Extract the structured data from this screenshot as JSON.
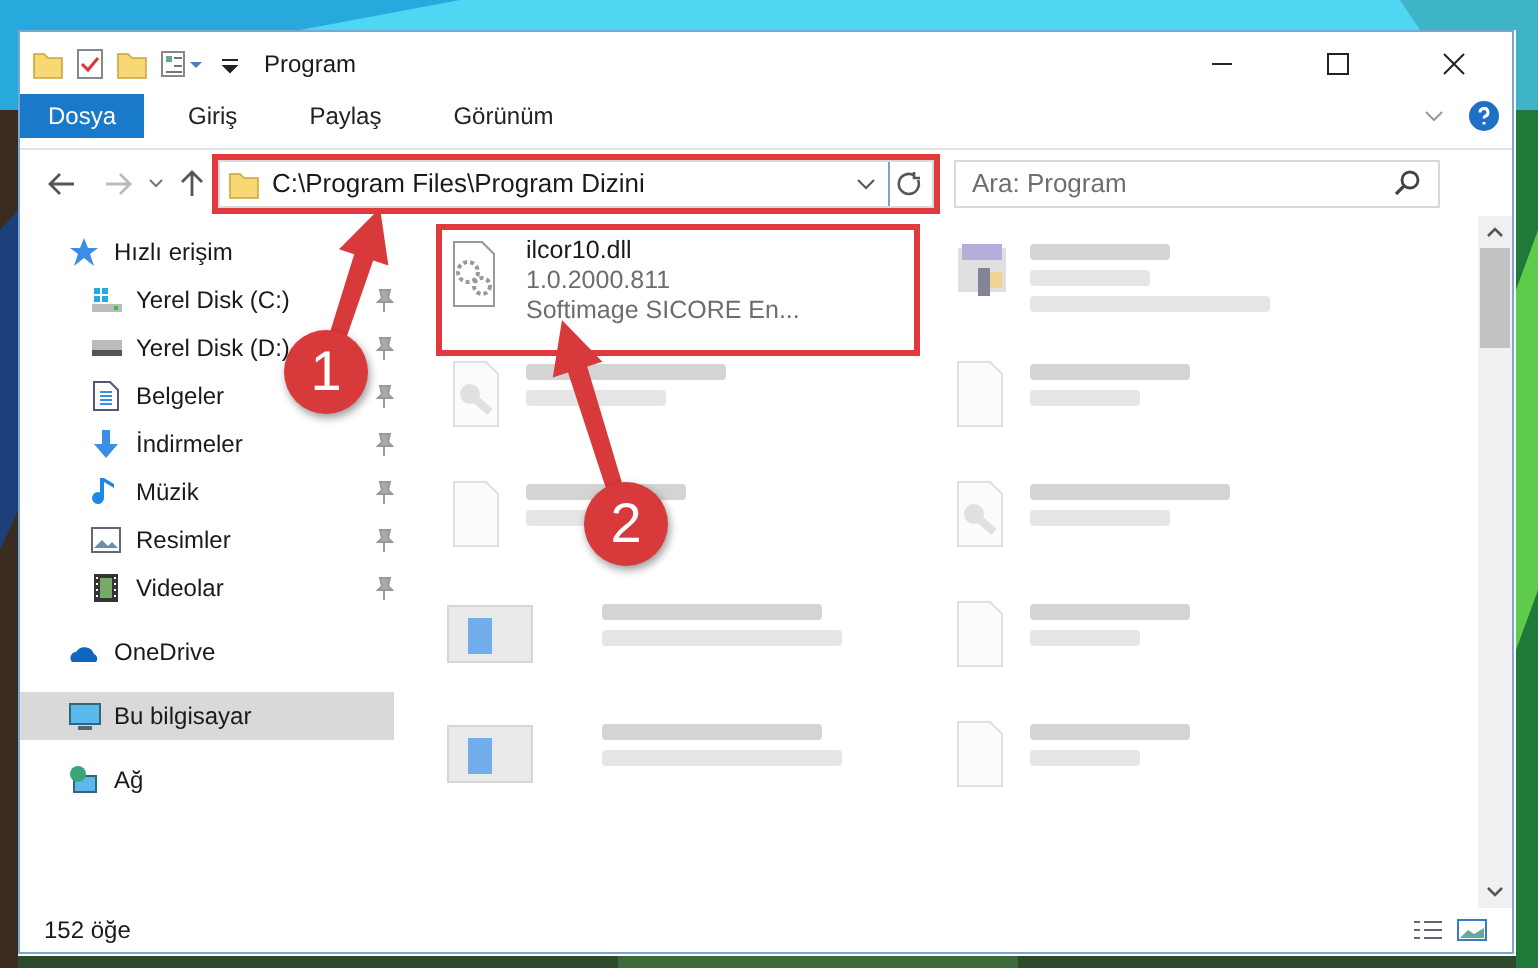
{
  "window": {
    "title": "Program"
  },
  "ribbon_tabs": [
    {
      "label": "Dosya",
      "selected": true
    },
    {
      "label": "Giriş",
      "selected": false
    },
    {
      "label": "Paylaş",
      "selected": false
    },
    {
      "label": "Görünüm",
      "selected": false
    }
  ],
  "address_bar": {
    "path": "C:\\Program Files\\Program Dizini",
    "highlighted": true
  },
  "search": {
    "placeholder": "Ara: Program"
  },
  "nav_pane": [
    {
      "label": "Hızlı erişim",
      "kind": "star",
      "selected": false,
      "children": [
        {
          "label": "Yerel Disk (C:)",
          "kind": "windrive",
          "pinned": true
        },
        {
          "label": "Yerel Disk (D:)",
          "kind": "drive",
          "pinned": true
        },
        {
          "label": "Belgeler",
          "kind": "docs",
          "pinned": true
        },
        {
          "label": "İndirmeler",
          "kind": "download",
          "pinned": true
        },
        {
          "label": "Müzik",
          "kind": "music",
          "pinned": true
        },
        {
          "label": "Resimler",
          "kind": "pictures",
          "pinned": true
        },
        {
          "label": "Videolar",
          "kind": "video",
          "pinned": true
        }
      ]
    },
    {
      "label": "OneDrive",
      "kind": "cloud",
      "selected": false
    },
    {
      "label": "Bu bilgisayar",
      "kind": "pc",
      "selected": true
    },
    {
      "label": "Ağ",
      "kind": "network",
      "selected": false
    }
  ],
  "files": [
    {
      "name": "ilcor10.dll",
      "lines": [
        "1.0.2000.811",
        "Softimage SICORE En..."
      ],
      "kind": "gears",
      "blurred": false,
      "highlighted": true
    },
    {
      "kind": "app",
      "blurred": true,
      "highlighted": false
    },
    {
      "kind": "key",
      "blurred": true,
      "highlighted": false
    },
    {
      "kind": "blank",
      "blurred": true,
      "highlighted": false
    },
    {
      "kind": "blank",
      "blurred": true,
      "highlighted": false
    },
    {
      "kind": "key",
      "blurred": true,
      "highlighted": false
    },
    {
      "kind": "window",
      "blurred": true,
      "highlighted": false
    },
    {
      "kind": "blank",
      "blurred": true,
      "highlighted": false
    },
    {
      "kind": "window",
      "blurred": true,
      "highlighted": false
    },
    {
      "kind": "blank",
      "blurred": true,
      "highlighted": false
    }
  ],
  "status_bar": {
    "count": "152 öğe"
  },
  "annotations": [
    {
      "label": "1"
    },
    {
      "label": "2"
    }
  ]
}
